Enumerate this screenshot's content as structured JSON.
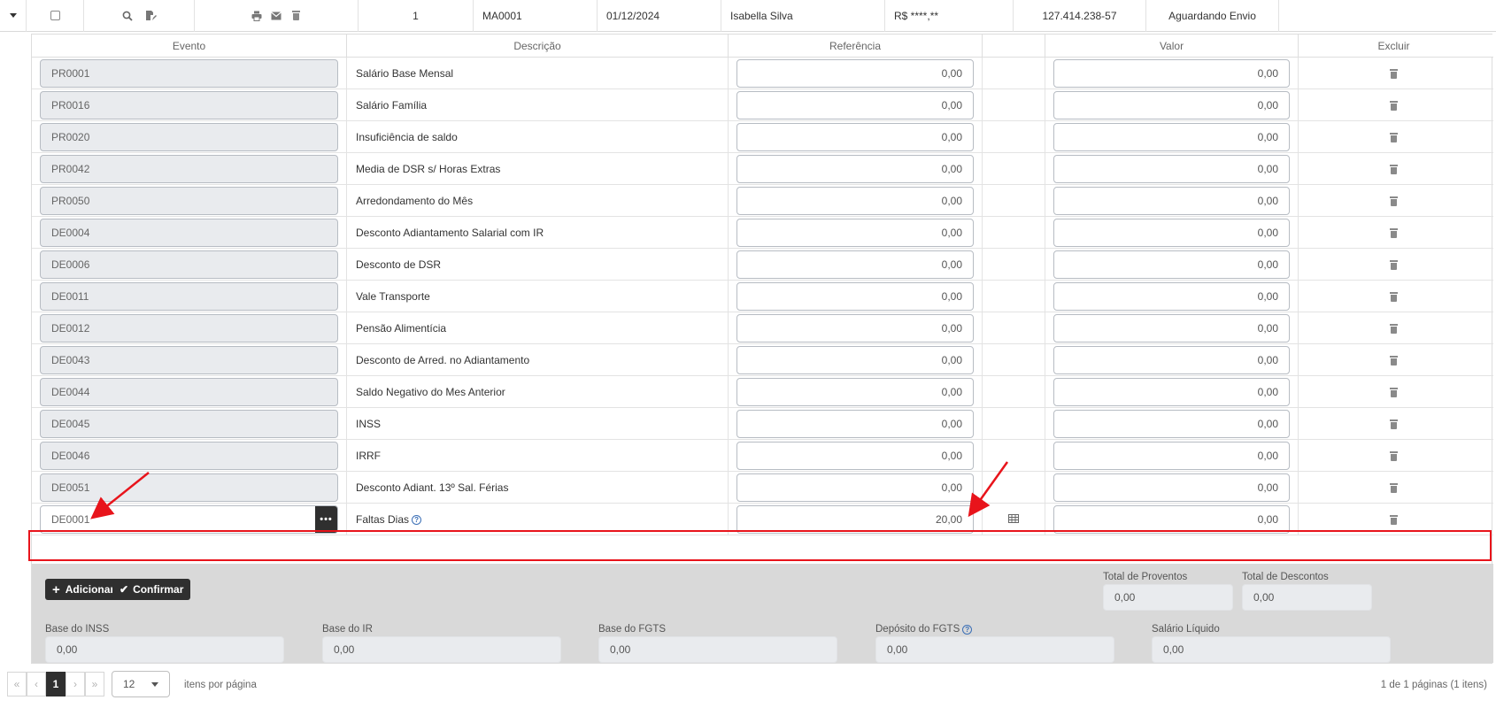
{
  "top_row": {
    "index": "1",
    "code": "MA0001",
    "date": "01/12/2024",
    "name": "Isabella Silva",
    "amount": "R$ ****,**",
    "document": "127.414.238-57",
    "status": "Aguardando Envio",
    "icons": [
      "expand-caret-icon",
      "search-icon",
      "edit-document-icon",
      "print-icon",
      "mail-icon",
      "trash-icon"
    ]
  },
  "table": {
    "headers": {
      "evento": "Evento",
      "descricao": "Descrição",
      "referencia": "Referência",
      "calc": "",
      "valor": "Valor",
      "excluir": "Excluir"
    },
    "rows": [
      {
        "evento": "PR0001",
        "descricao": "Salário Base Mensal",
        "referencia": "0,00",
        "valor": "0,00"
      },
      {
        "evento": "PR0016",
        "descricao": "Salário Família",
        "referencia": "0,00",
        "valor": "0,00"
      },
      {
        "evento": "PR0020",
        "descricao": "Insuficiência de saldo",
        "referencia": "0,00",
        "valor": "0,00"
      },
      {
        "evento": "PR0042",
        "descricao": "Media de DSR s/ Horas Extras",
        "referencia": "0,00",
        "valor": "0,00"
      },
      {
        "evento": "PR0050",
        "descricao": "Arredondamento do Mês",
        "referencia": "0,00",
        "valor": "0,00"
      },
      {
        "evento": "DE0004",
        "descricao": "Desconto Adiantamento Salarial com IR",
        "referencia": "0,00",
        "valor": "0,00"
      },
      {
        "evento": "DE0006",
        "descricao": "Desconto de DSR",
        "referencia": "0,00",
        "valor": "0,00"
      },
      {
        "evento": "DE0011",
        "descricao": "Vale Transporte",
        "referencia": "0,00",
        "valor": "0,00"
      },
      {
        "evento": "DE0012",
        "descricao": "Pensão Alimentícia",
        "referencia": "0,00",
        "valor": "0,00"
      },
      {
        "evento": "DE0043",
        "descricao": "Desconto de Arred. no Adiantamento",
        "referencia": "0,00",
        "valor": "0,00"
      },
      {
        "evento": "DE0044",
        "descricao": "Saldo Negativo do Mes Anterior",
        "referencia": "0,00",
        "valor": "0,00"
      },
      {
        "evento": "DE0045",
        "descricao": "INSS",
        "referencia": "0,00",
        "valor": "0,00"
      },
      {
        "evento": "DE0046",
        "descricao": "IRRF",
        "referencia": "0,00",
        "valor": "0,00"
      },
      {
        "evento": "DE0051",
        "descricao": "Desconto Adiant. 13º Sal. Férias",
        "referencia": "0,00",
        "valor": "0,00"
      }
    ],
    "edit_row": {
      "evento": "DE0001",
      "descricao": "Faltas Dias",
      "referencia": "20,00",
      "valor": "0,00",
      "lookup_label": "•••"
    }
  },
  "summary": {
    "add_label": "Adicionar",
    "confirm_label": "Confirmar",
    "total_proventos_label": "Total de Proventos",
    "total_proventos": "0,00",
    "total_descontos_label": "Total de Descontos",
    "total_descontos": "0,00",
    "base_inss_label": "Base do INSS",
    "base_inss": "0,00",
    "base_ir_label": "Base do IR",
    "base_ir": "0,00",
    "base_fgts_label": "Base do FGTS",
    "base_fgts": "0,00",
    "deposito_fgts_label": "Depósito do FGTS",
    "deposito_fgts": "0,00",
    "salario_liquido_label": "Salário Líquido",
    "salario_liquido": "0,00"
  },
  "pager": {
    "first": "«",
    "prev": "‹",
    "page": "1",
    "next": "›",
    "last": "»",
    "per_page": "12",
    "per_page_label": "itens por página",
    "info": "1 de 1 páginas (1 itens)"
  },
  "colors": {
    "highlight": "#e8141b",
    "dark_button": "#2f2f2f",
    "summary_bg": "#d9d9d9",
    "readonly_bg": "#e9ebee"
  }
}
